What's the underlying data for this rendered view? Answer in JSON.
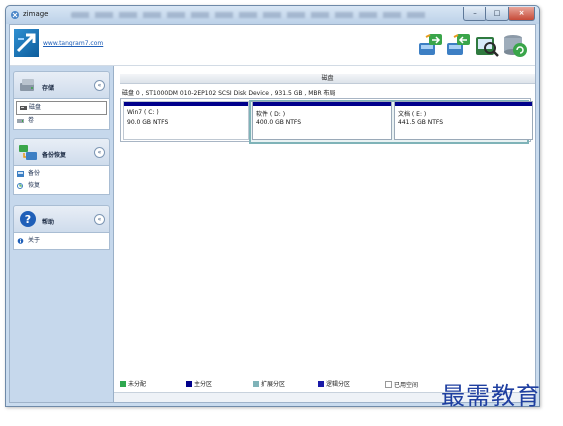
{
  "window": {
    "title": "zimage",
    "controls": {
      "minimize": "–",
      "maximize": "□",
      "close": "×"
    }
  },
  "header": {
    "site_link": "www.tangram7.com",
    "toolbar_icons": [
      "backup-disk-icon",
      "restore-disk-icon",
      "search-disk-icon",
      "settings-disk-icon"
    ]
  },
  "sidebar": {
    "panels": [
      {
        "title": "存储",
        "icon": "storage-icon",
        "items": [
          {
            "label": "磁盘",
            "selected": true
          },
          {
            "label": "卷",
            "selected": false
          }
        ]
      },
      {
        "title": "备份恢复",
        "icon": "backup-restore-icon",
        "items": [
          {
            "label": "备份"
          },
          {
            "label": "恢复"
          }
        ]
      },
      {
        "title": "帮助",
        "icon": "help-icon",
        "items": [
          {
            "label": "关于"
          }
        ]
      }
    ],
    "collapse_glyph": "«"
  },
  "main": {
    "section_title": "磁盘",
    "disk_info": "磁盘 0 , ST1000DM 010-2EP102 SCSI Disk Device , 931.5 GB , MBR 布局",
    "partitions": [
      {
        "name": "Win7 ( C: )",
        "size": "90.0 GB NTFS"
      },
      {
        "name": "软件 ( D: )",
        "size": "400.0 GB NTFS"
      },
      {
        "name": "文档 ( E: )",
        "size": "441.5 GB NTFS"
      }
    ],
    "legend": [
      {
        "label": "未分配",
        "color": "#2fa84f"
      },
      {
        "label": "主分区",
        "color": "#00008b"
      },
      {
        "label": "扩展分区",
        "color": "#7fb3b8"
      },
      {
        "label": "逻辑分区",
        "color": "#1a1aa8"
      },
      {
        "label": "已用空间",
        "color": "#ffffff"
      }
    ]
  },
  "colors": {
    "window_frame": "#c9dbee",
    "sidebar_bg": "#c6d8ec",
    "partition_bar": "#00008b",
    "extended_border": "#7fb3b8"
  },
  "watermark": "最需教育"
}
